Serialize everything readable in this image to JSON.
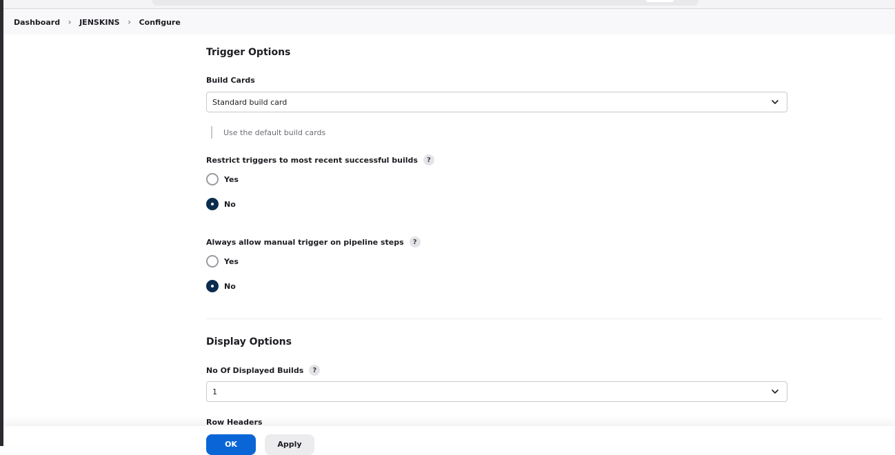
{
  "breadcrumb": [
    "Dashboard",
    "JENSKINS",
    "Configure"
  ],
  "trigger_options": {
    "title": "Trigger Options",
    "build_cards": {
      "label": "Build Cards",
      "value": "Standard build card",
      "hint": "Use the default build cards"
    },
    "restrict_triggers": {
      "label": "Restrict triggers to most recent successful builds",
      "options": [
        "Yes",
        "No"
      ],
      "selected": "No"
    },
    "manual_trigger": {
      "label": "Always allow manual trigger on pipeline steps",
      "options": [
        "Yes",
        "No"
      ],
      "selected": "No"
    }
  },
  "display_options": {
    "title": "Display Options",
    "displayed_builds": {
      "label": "No Of Displayed Builds",
      "value": "1"
    },
    "row_headers_label": "Row Headers"
  },
  "help_glyph": "?",
  "buttons": {
    "ok": "OK",
    "apply": "Apply"
  },
  "colors": {
    "primary": "#0a66d6",
    "radio_checked": "#0b2e4e"
  }
}
